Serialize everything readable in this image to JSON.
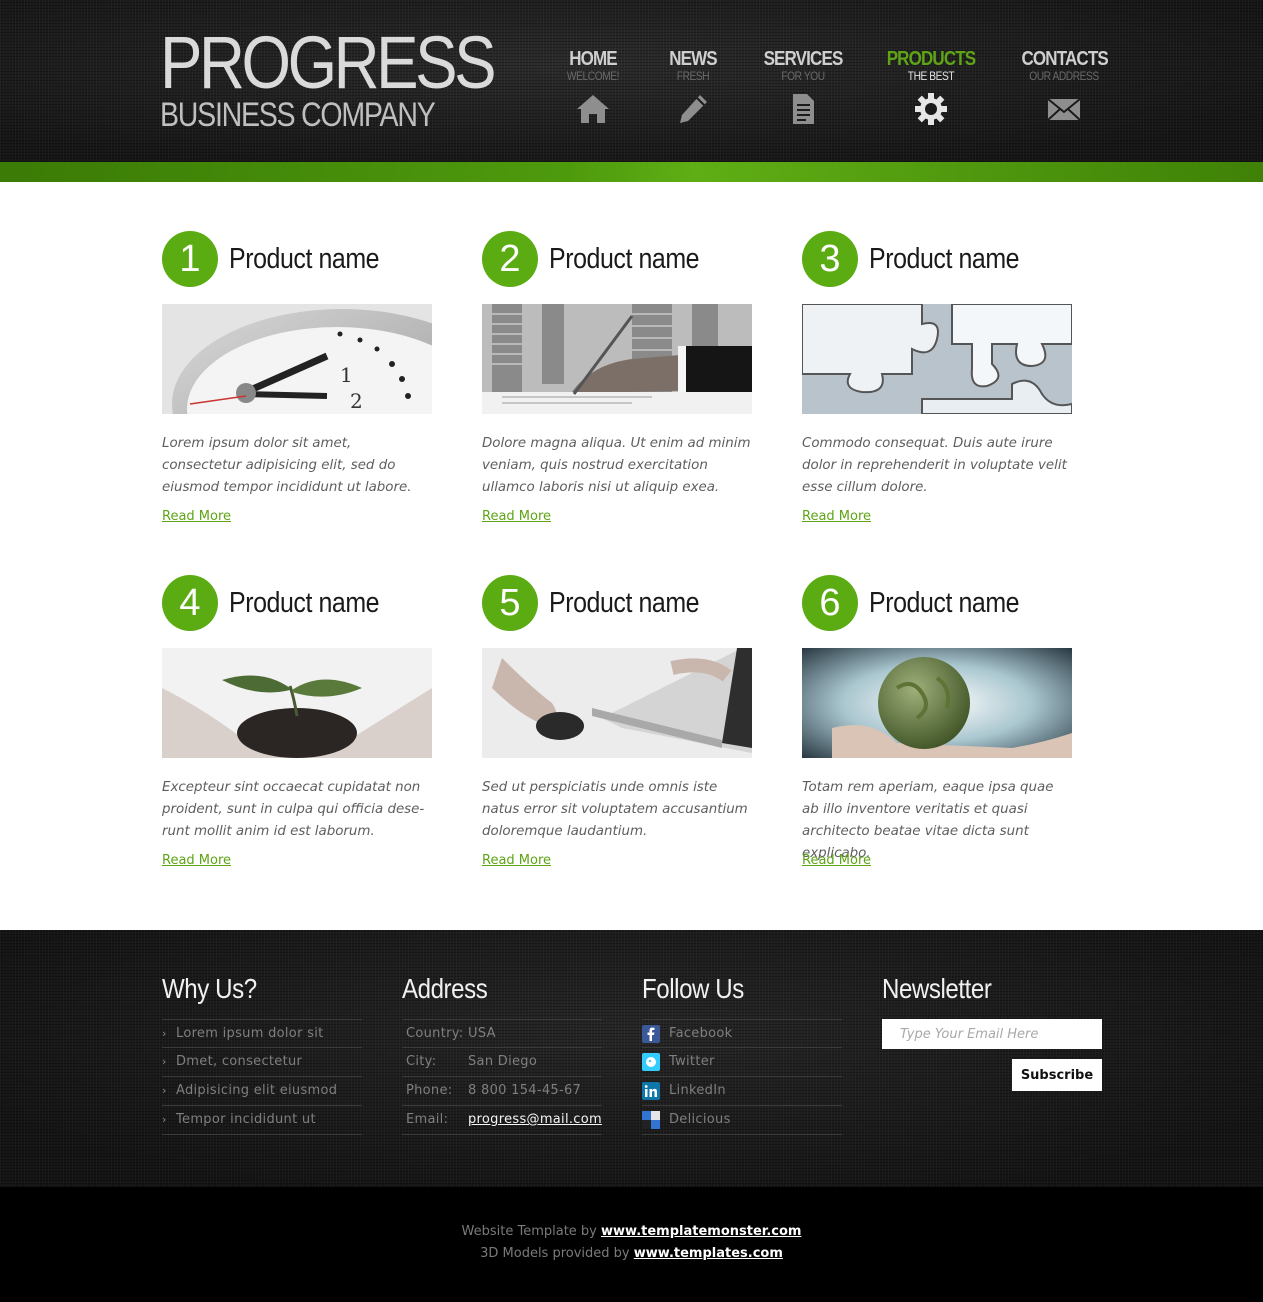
{
  "logo": {
    "main": "PROGRESS",
    "sub": "BUSINESS COMPANY"
  },
  "nav": [
    {
      "title": "HOME",
      "sub": "WELCOME!",
      "icon": "home-icon"
    },
    {
      "title": "NEWS",
      "sub": "FRESH",
      "icon": "pencil-icon"
    },
    {
      "title": "SERVICES",
      "sub": "FOR YOU",
      "icon": "document-icon"
    },
    {
      "title": "PRODUCTS",
      "sub": "THE BEST",
      "icon": "gear-icon",
      "active": true
    },
    {
      "title": "CONTACTS",
      "sub": "OUR ADDRESS",
      "icon": "envelope-icon"
    }
  ],
  "colors": {
    "accent": "#5ea416",
    "header_bg": "#1b1b1b",
    "footer_bg": "#1d1d1d"
  },
  "products": [
    {
      "number": "1",
      "title": "Product name",
      "image": "clock-image",
      "text": "Lorem ipsum dolor sit amet, consectetur adipisicing elit, sed do eiusmod tempor incididunt ut labore.",
      "link": "Read More"
    },
    {
      "number": "2",
      "title": "Product name",
      "image": "hand-writing-image",
      "text": "Dolore magna aliqua. Ut enim ad minim veniam, quis nostrud exercitation ullamco laboris nisi ut aliquip exea.",
      "link": "Read More"
    },
    {
      "number": "3",
      "title": "Product name",
      "image": "puzzle-image",
      "text": "Commodo consequat. Duis aute irure dolor in reprehenderit in voluptate velit esse cillum dolore.",
      "link": "Read More"
    },
    {
      "number": "4",
      "title": "Product name",
      "image": "plant-in-hands-image",
      "text": "Excepteur sint occaecat cupidatat non proident, sunt in culpa qui officia dese-runt mollit anim id est laborum.",
      "link": "Read More"
    },
    {
      "number": "5",
      "title": "Product name",
      "image": "laptop-mouse-image",
      "text": "Sed ut perspiciatis unde omnis iste natus error sit voluptatem accusantium doloremque laudantium.",
      "link": "Read More"
    },
    {
      "number": "6",
      "title": "Product name",
      "image": "globe-in-hands-image",
      "text": "Totam rem aperiam, eaque ipsa quae ab illo inventore veritatis et quasi architecto beatae vitae dicta sunt explicabo.",
      "link": "Read More"
    }
  ],
  "footer": {
    "why": {
      "title": "Why Us?",
      "items": [
        "Lorem ipsum dolor sit",
        "Dmet, consectetur",
        "Adipisicing elit eiusmod",
        "Tempor incididunt ut"
      ]
    },
    "address": {
      "title": "Address",
      "rows": [
        {
          "label": "Country:",
          "value": "USA"
        },
        {
          "label": "City:",
          "value": "San Diego"
        },
        {
          "label": "Phone:",
          "value": "8 800 154-45-67"
        },
        {
          "label": "Email:",
          "value": "progress@mail.com"
        }
      ]
    },
    "follow": {
      "title": "Follow Us",
      "items": [
        {
          "label": "Facebook",
          "icon": "facebook-icon",
          "color": "#3b5998"
        },
        {
          "label": "Twitter",
          "icon": "twitter-icon",
          "color": "#33ccff"
        },
        {
          "label": "LinkedIn",
          "icon": "linkedin-icon",
          "color": "#0e76a8"
        },
        {
          "label": "Delicious",
          "icon": "delicious-icon",
          "color": "#3274d1"
        }
      ]
    },
    "newsletter": {
      "title": "Newsletter",
      "placeholder": "Type Your Email Here",
      "button": "Subscribe"
    }
  },
  "credits": {
    "line1_text": "Website Template by ",
    "line1_link": "www.templatemonster.com",
    "line2_text": "3D Models provided by ",
    "line2_link": "www.templates.com"
  }
}
